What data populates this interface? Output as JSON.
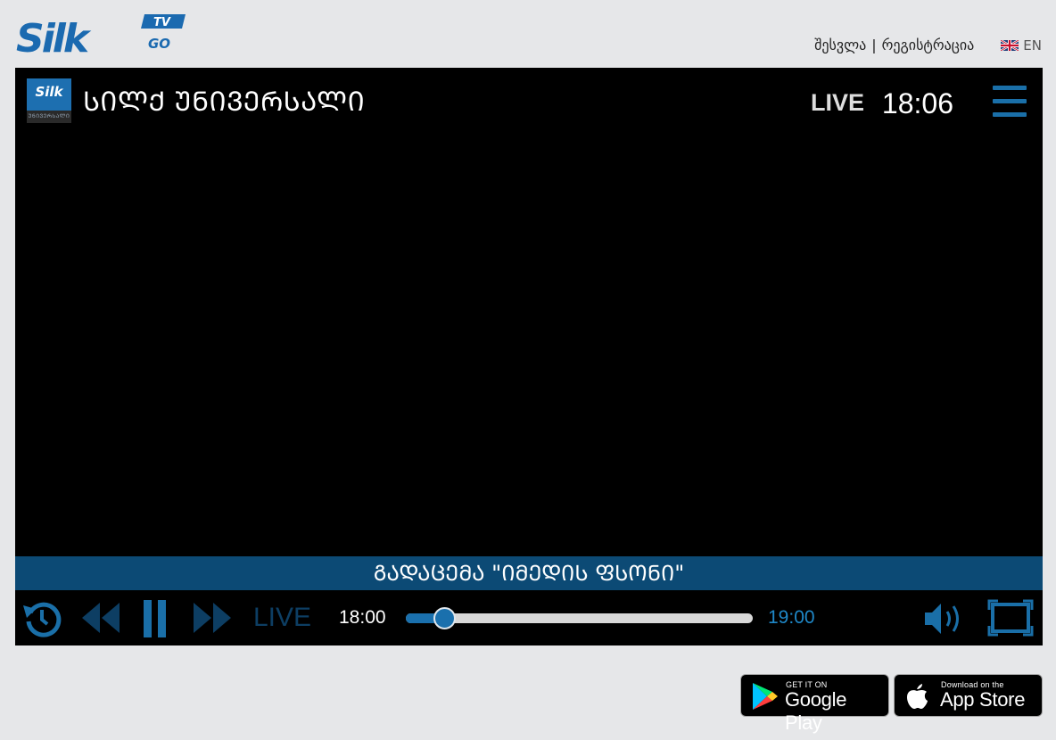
{
  "brand": {
    "logo_text": "Silk",
    "badge_tv": "TV",
    "badge_go": "GO"
  },
  "header": {
    "login_label": "შესვლა",
    "separator": "|",
    "register_label": "რეგისტრაცია",
    "language_label": "EN"
  },
  "player": {
    "channel_logo_text": "Silk",
    "channel_logo_sub": "ᲣᲜᲘᲕᲔᲠᲡᲐᲚᲘ",
    "channel_name": "ᲡᲘᲚᲥ ᲣᲜᲘᲕᲔᲠᲡᲐᲚᲘ",
    "live_label": "LIVE",
    "current_time": "18:06",
    "program_title": "ᲒᲐᲓᲐᲪᲔᲛᲐ \"ᲘᲛᲔᲓᲘᲡ ᲤᲡᲝᲜᲘ\""
  },
  "controls": {
    "live_label": "LIVE",
    "start_time": "18:00",
    "end_time": "19:00",
    "progress": 0.11,
    "accent_color": "#1a70ad"
  },
  "stores": {
    "google_small": "GET IT ON",
    "google_big": "Google Play",
    "apple_small": "Download on the",
    "apple_big": "App Store"
  }
}
